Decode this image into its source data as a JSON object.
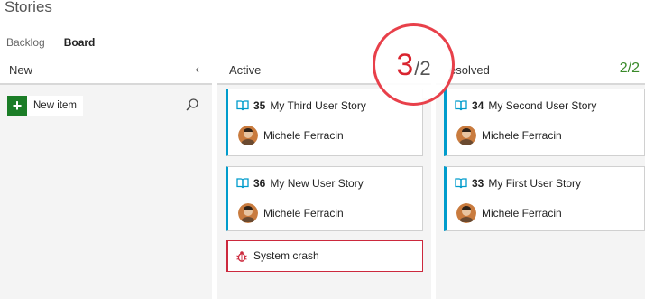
{
  "page": {
    "title": "Stories"
  },
  "tabs": [
    {
      "label": "Backlog"
    },
    {
      "label": "Board"
    }
  ],
  "columns": {
    "new": {
      "title": "New",
      "new_item_label": "New item"
    },
    "active": {
      "title": "Active",
      "cards": [
        {
          "id": "35",
          "title": "My Third User Story",
          "assignee": "Michele Ferracin",
          "type": "user-story"
        },
        {
          "id": "36",
          "title": "My New User Story",
          "assignee": "Michele Ferracin",
          "type": "user-story"
        },
        {
          "title": "System crash",
          "type": "bug"
        }
      ],
      "wip": {
        "count": "3",
        "limit": "/2"
      }
    },
    "resolved": {
      "title": "esolved",
      "wip": {
        "count": "2",
        "limit": "/2"
      },
      "cards": [
        {
          "id": "34",
          "title": "My Second User Story",
          "assignee": "Michele Ferracin",
          "type": "user-story"
        },
        {
          "id": "33",
          "title": "My First User Story",
          "assignee": "Michele Ferracin",
          "type": "user-story"
        }
      ]
    }
  },
  "colors": {
    "story_accent": "#009ccc",
    "bug_accent": "#cc293d",
    "new_button": "#1b7d27",
    "wip_ok": "#3a8a2a",
    "wip_exceeded": "#d9242f"
  },
  "icons": {
    "collapse": "chevron-left-icon",
    "search": "search-icon",
    "story": "book-icon",
    "bug": "bug-icon"
  }
}
